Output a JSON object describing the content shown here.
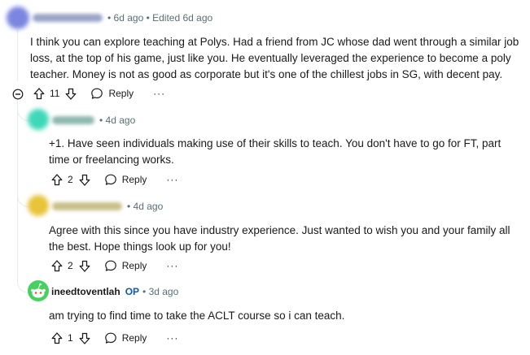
{
  "comments": [
    {
      "meta": "• 6d ago • Edited 6d ago",
      "body": "I think you can explore teaching at Polys. Had a friend from JC whose dad went through a similar job loss, at the top of his game, just like you. He eventually leveraged the experience to become a poly teacher. Money is not as good as corporate but it's one of the chillest jobs in SG, with decent pay.",
      "votes": "11",
      "reply_label": "Reply",
      "more_label": "···",
      "avatar_color": "#7b86e0"
    },
    {
      "meta": "• 4d ago",
      "body": "+1. Have seen individuals making use of their skills to teach. You don't have to go for FT, part time or freelancing works.",
      "votes": "2",
      "reply_label": "Reply",
      "more_label": "···",
      "avatar_color": "#3ed8b8"
    },
    {
      "meta": "• 4d ago",
      "body": "Agree with this since you have industry experience. Just wanted to wish you and your family all the best. Hope things look up for you!",
      "votes": "2",
      "reply_label": "Reply",
      "more_label": "···",
      "avatar_color": "#e8c43a"
    },
    {
      "username": "ineedtoventlah",
      "op_label": "OP",
      "meta": "• 3d ago",
      "body": "am trying to find time to take the ACLT course so i can teach.",
      "votes": "1",
      "reply_label": "Reply",
      "more_label": "···",
      "avatar_color": "#46d160"
    }
  ]
}
